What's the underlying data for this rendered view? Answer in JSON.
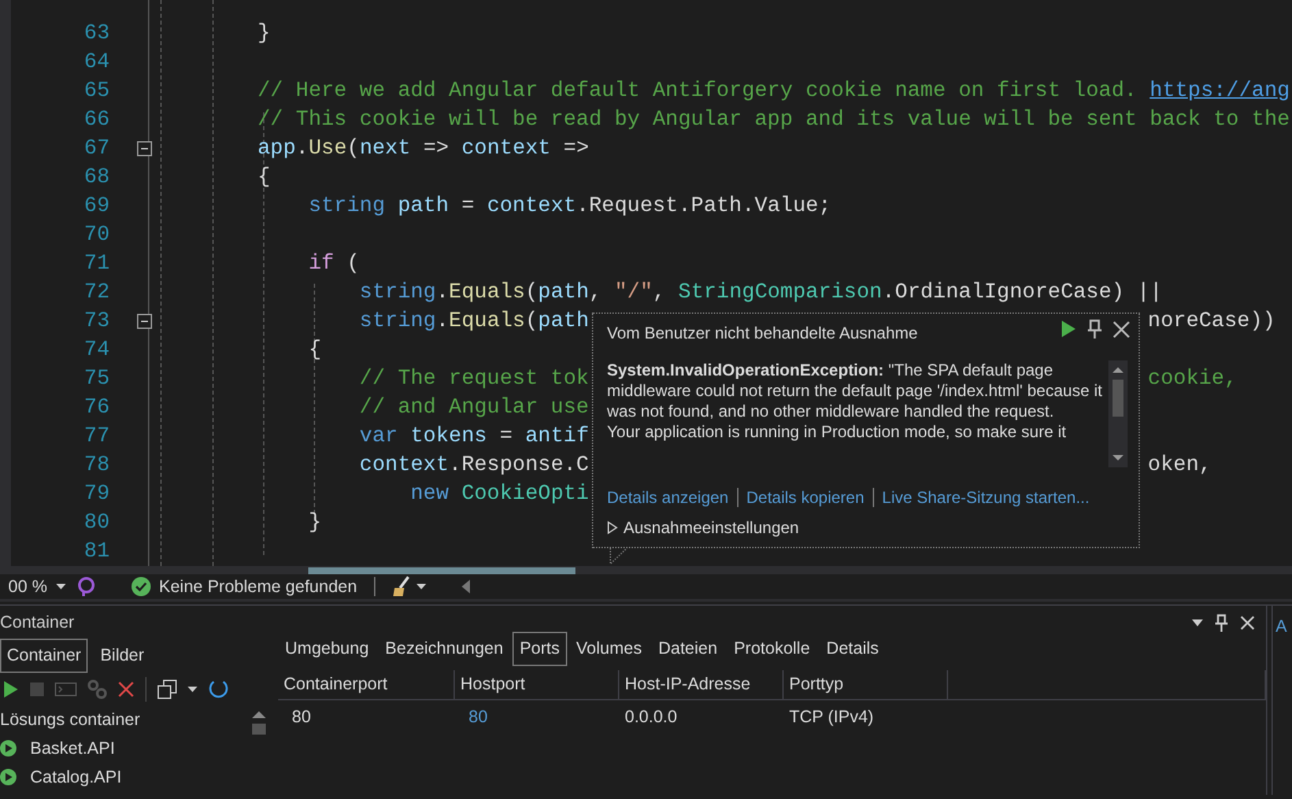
{
  "editor": {
    "lines": [
      {
        "number": "63",
        "tokens": [
          {
            "kind": "plain",
            "text": "}"
          }
        ]
      },
      {
        "number": "64"
      },
      {
        "number": "65",
        "tokens": [
          {
            "kind": "comment",
            "text": "// Here we add Angular default Antiforgery cookie name on first load. "
          },
          {
            "kind": "link",
            "text": "https://ang"
          }
        ]
      },
      {
        "number": "66",
        "tokens": [
          {
            "kind": "comment",
            "text": "// This cookie will be read by Angular app and its value will be sent back to the"
          }
        ]
      },
      {
        "number": "67",
        "fold": true,
        "tokens": [
          {
            "kind": "variable",
            "text": "app"
          },
          {
            "kind": "plain",
            "text": "."
          },
          {
            "kind": "method",
            "text": "Use"
          },
          {
            "kind": "plain",
            "text": "("
          },
          {
            "kind": "variable",
            "text": "next"
          },
          {
            "kind": "plain",
            "text": " => "
          },
          {
            "kind": "variable",
            "text": "context"
          },
          {
            "kind": "plain",
            "text": " =>"
          }
        ]
      },
      {
        "number": "68",
        "tokens": [
          {
            "kind": "plain",
            "text": "{"
          }
        ]
      },
      {
        "number": "69",
        "tokens": [
          {
            "kind": "keyword",
            "text": "    string"
          },
          {
            "kind": "variable",
            "text": " path"
          },
          {
            "kind": "plain",
            "text": " = "
          },
          {
            "kind": "variable",
            "text": "context"
          },
          {
            "kind": "plain",
            "text": ".Request.Path.Value;"
          }
        ]
      },
      {
        "number": "70"
      },
      {
        "number": "71",
        "tokens": [
          {
            "kind": "control",
            "text": "    if"
          },
          {
            "kind": "plain",
            "text": " ("
          }
        ]
      },
      {
        "number": "72",
        "tokens": [
          {
            "kind": "keyword",
            "text": "        string"
          },
          {
            "kind": "plain",
            "text": "."
          },
          {
            "kind": "method",
            "text": "Equals"
          },
          {
            "kind": "plain",
            "text": "("
          },
          {
            "kind": "variable",
            "text": "path"
          },
          {
            "kind": "plain",
            "text": ", "
          },
          {
            "kind": "string",
            "text": "\"/\""
          },
          {
            "kind": "plain",
            "text": ", "
          },
          {
            "kind": "type",
            "text": "StringComparison"
          },
          {
            "kind": "plain",
            "text": ".OrdinalIgnoreCase) ||"
          }
        ]
      },
      {
        "number": "73",
        "fold": true,
        "tokens": [
          {
            "kind": "keyword",
            "text": "        string"
          },
          {
            "kind": "plain",
            "text": "."
          },
          {
            "kind": "method",
            "text": "Equals"
          },
          {
            "kind": "plain",
            "text": "("
          },
          {
            "kind": "variable",
            "text": "path"
          }
        ],
        "right": {
          "kind": "plain",
          "text": "noreCase))"
        }
      },
      {
        "number": "74",
        "tokens": [
          {
            "kind": "plain",
            "text": "    {"
          }
        ]
      },
      {
        "number": "75",
        "tokens": [
          {
            "kind": "comment",
            "text": "        // The request tok"
          }
        ],
        "right": {
          "kind": "comment",
          "text": "cookie,"
        }
      },
      {
        "number": "76",
        "tokens": [
          {
            "kind": "comment",
            "text": "        // and Angular use"
          }
        ]
      },
      {
        "number": "77",
        "tokens": [
          {
            "kind": "keyword",
            "text": "        var"
          },
          {
            "kind": "variable",
            "text": " tokens"
          },
          {
            "kind": "plain",
            "text": " = "
          },
          {
            "kind": "variable",
            "text": "antif"
          }
        ]
      },
      {
        "number": "78",
        "tokens": [
          {
            "kind": "variable",
            "text": "        context"
          },
          {
            "kind": "plain",
            "text": ".Response.C"
          }
        ],
        "right": {
          "kind": "plain",
          "text": "oken,"
        }
      },
      {
        "number": "79",
        "tokens": [
          {
            "kind": "keyword",
            "text": "            new"
          },
          {
            "kind": "type",
            "text": " CookieOpti"
          }
        ]
      },
      {
        "number": "80",
        "tokens": [
          {
            "kind": "plain",
            "text": "    }"
          }
        ]
      },
      {
        "number": "81"
      }
    ]
  },
  "exception_popup": {
    "title": "Vom Benutzer nicht behandelte Ausnahme",
    "message": [
      "**System.InvalidOperationException:** \"The SPA default page middleware could not return the default page '/index.html' because it was not found, and no other middleware handled the request.",
      "Your application is running in Production mode, so make sure it"
    ],
    "links": [
      "Details anzeigen",
      "Details kopieren",
      "Live Share-Sitzung starten..."
    ],
    "settings": {
      "label": "Ausnahmeeinstellungen",
      "expanded": false
    }
  },
  "status_bar": {
    "zoom": "00 %",
    "problems": "Keine Probleme gefunden"
  },
  "container_panel": {
    "title": "Container",
    "tabs": [
      {
        "label": "Container",
        "selected": true
      },
      {
        "label": "Bilder",
        "selected": false
      }
    ],
    "tree": {
      "label": "Lösungs container",
      "children": [
        {
          "label": "Basket.API",
          "running": true
        },
        {
          "label": "Catalog.API",
          "running": true
        }
      ]
    },
    "detail_tabs": [
      {
        "label": "Umgebung",
        "selected": false
      },
      {
        "label": "Bezeichnungen",
        "selected": false
      },
      {
        "label": "Ports",
        "selected": true
      },
      {
        "label": "Volumes",
        "selected": false
      },
      {
        "label": "Dateien",
        "selected": false
      },
      {
        "label": "Protokolle",
        "selected": false
      },
      {
        "label": "Details",
        "selected": false
      }
    ],
    "table": {
      "columns": [
        "Containerport",
        "Hostport",
        "Host-IP-Adresse",
        "Porttyp"
      ],
      "rows": [
        {
          "cells": [
            {
              "text": "80",
              "link": false
            },
            {
              "text": "80",
              "link": true
            },
            {
              "text": "0.0.0.0",
              "link": false
            },
            {
              "text": "TCP (IPv4)",
              "link": false
            }
          ]
        }
      ]
    }
  },
  "side_panel": {
    "tab": "A"
  }
}
